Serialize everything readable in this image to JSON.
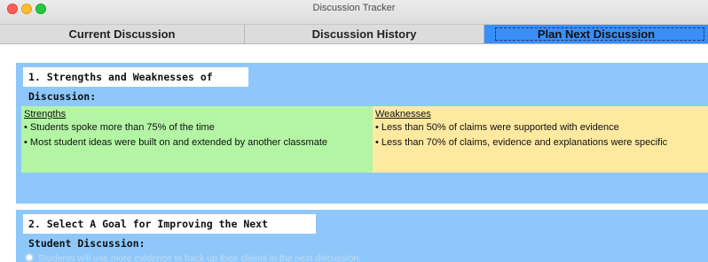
{
  "window": {
    "title": "Discussion Tracker"
  },
  "tabs": [
    {
      "label": "Current Discussion"
    },
    {
      "label": "Discussion History"
    },
    {
      "label": "Plan Next Discussion"
    }
  ],
  "section1": {
    "heading": "1. Strengths and Weaknesses of Discussion:",
    "strengths": {
      "title": "Strengths",
      "items": [
        "• Students spoke more than 75% of the time",
        "• Most student ideas were built on and extended by another classmate"
      ]
    },
    "weaknesses": {
      "title": "Weaknesses",
      "items": [
        "• Less than 50% of claims were supported with evidence",
        "• Less than 70% of claims, evidence and explanations were specific"
      ]
    }
  },
  "section2": {
    "heading": "2. Select A Goal for Improving the Next Student Discussion:",
    "option": "Students will use more evidence to back up their claims in the next discussion."
  },
  "colors": {
    "active_tab": "#3a8ef7",
    "panel": "#8ec8fb",
    "strengths_bg": "#b3f5a5",
    "weaknesses_bg": "#fde9a0"
  }
}
